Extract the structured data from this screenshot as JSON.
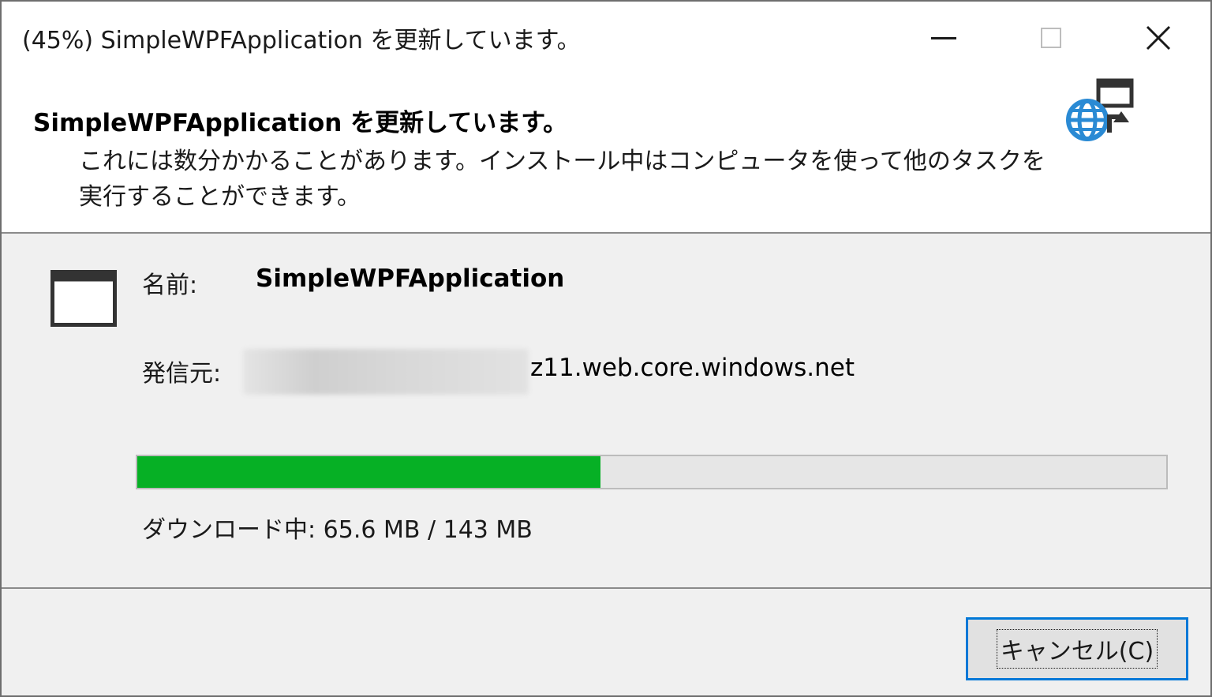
{
  "window": {
    "title": "(45%) SimpleWPFApplication を更新しています。",
    "controls": {
      "minimize_icon": "minimize-icon",
      "maximize_icon": "maximize-icon",
      "close_icon": "close-icon",
      "close_glyph": "✕"
    }
  },
  "header": {
    "title": "SimpleWPFApplication を更新しています。",
    "description": "これには数分かかることがあります。インストール中はコンピュータを使って他のタスクを実行することができます。",
    "icon": "globe-update-icon"
  },
  "details": {
    "app_icon": "application-window-icon",
    "name_label": "名前:",
    "name_value": "SimpleWPFApplication",
    "from_label": "発信元:",
    "from_value": "z11.web.core.windows.net"
  },
  "progress": {
    "percent": 45,
    "status_text": "ダウンロード中: 65.6 MB / 143 MB",
    "fill_color": "#06b025"
  },
  "footer": {
    "cancel_label": "キャンセル(C)"
  },
  "colors": {
    "accent": "#0078d7",
    "background": "#f0f0f0",
    "header_background": "#ffffff"
  }
}
